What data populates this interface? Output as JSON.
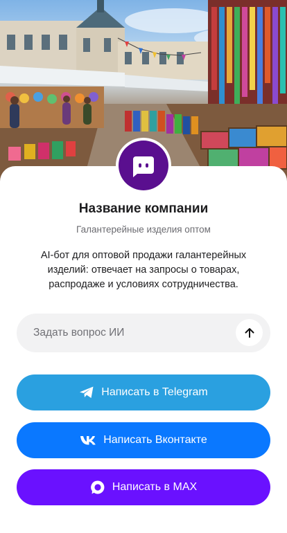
{
  "profile": {
    "name": "Название компании",
    "tagline": "Галантерейные изделия оптом",
    "description": "AI-бот для оптовой продажи галантерейных изделий: отвечает на запросы о товарах, распродаже и условиях сотрудничества.",
    "avatar_icon": "chat-bot-icon",
    "avatar_color": "#5a0f8f"
  },
  "ask": {
    "placeholder": "Задать вопрос ИИ",
    "send_icon": "arrow-up-icon"
  },
  "actions": {
    "telegram": {
      "label": "Написать в Telegram",
      "icon": "telegram-icon",
      "color": "#2aa0e0"
    },
    "vk": {
      "label": "Написать Вконтакте",
      "icon": "vk-icon",
      "color": "#0a78ff"
    },
    "max": {
      "label": "Написать в MAX",
      "icon": "max-icon",
      "color": "#6a11ff"
    }
  },
  "hero": {
    "image": "market-stalls-illustration"
  }
}
